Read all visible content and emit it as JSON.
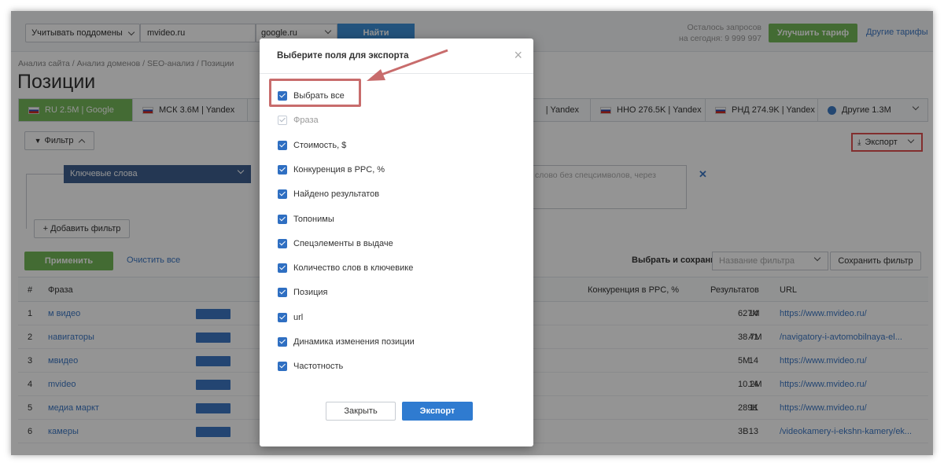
{
  "topbar": {
    "subdomains_label": "Учитывать поддомены",
    "domain_value": "mvideo.ru",
    "search_engine": "google.ru",
    "find_label": "Найти",
    "quota_line1": "Осталось запросов",
    "quota_line2": "на сегодня: 9 999 997",
    "upgrade_label": "Улучшить тариф",
    "other_plans_label": "Другие тарифы"
  },
  "breadcrumb": "Анализ сайта / Анализ доменов / SEO-анализ / Позиции",
  "page_title": "Позиции",
  "region_tabs": [
    {
      "label": "RU 2.5M | Google"
    },
    {
      "label": "МСК 3.6M | Yandex"
    },
    {
      "label": "| Yandex"
    },
    {
      "label": "ННО 276.5K | Yandex"
    },
    {
      "label": "РНД 274.9K | Yandex"
    },
    {
      "label": "Другие 1.3M"
    }
  ],
  "filter": {
    "filter_label": "Фильтр",
    "export_label": "Экспорт",
    "keywords_label": "Ключевые слова",
    "keywords_placeholder": "слово без спецсимволов, через",
    "add_filter_label": "+ Добавить фильтр",
    "apply_label": "Применить",
    "clear_label": "Очистить все",
    "choose_save_label": "Выбрать и сохранить",
    "filter_name_placeholder": "Название фильтра",
    "save_filter_label": "Сохранить фильтр"
  },
  "table": {
    "headers": {
      "num": "#",
      "phrase": "Фраза",
      "ppc": "Конкуренция в PPC, %",
      "results": "Результатов",
      "url": "URL"
    },
    "rows": [
      {
        "num": "1",
        "phrase": "м видео",
        "ppc": "14",
        "results": "627M",
        "url": "https://www.mvideo.ru/"
      },
      {
        "num": "2",
        "phrase": "навигаторы",
        "ppc": "41",
        "results": "38.7M",
        "url": "/navigatory-i-avtomobilnaya-el..."
      },
      {
        "num": "3",
        "phrase": "мвидео",
        "ppc": "14",
        "results": "5M",
        "url": "https://www.mvideo.ru/"
      },
      {
        "num": "4",
        "phrase": "mvideo",
        "ppc": "14",
        "results": "10.2M",
        "url": "https://www.mvideo.ru/"
      },
      {
        "num": "5",
        "phrase": "медиа маркт",
        "ppc": "11",
        "results": "289K",
        "url": "https://www.mvideo.ru/"
      },
      {
        "num": "6",
        "phrase": "камеры",
        "ppc": "13",
        "results": "3B",
        "url": "/videokamery-i-ekshn-kamery/ek..."
      }
    ]
  },
  "modal": {
    "title": "Выберите поля для экспорта",
    "fields": [
      {
        "label": "Выбрать все",
        "checked": true
      },
      {
        "label": "Фраза",
        "checked": true,
        "disabled": true
      },
      {
        "label": "Стоимость, $",
        "checked": true
      },
      {
        "label": "Конкуренция в PPC, %",
        "checked": true
      },
      {
        "label": "Найдено результатов",
        "checked": true
      },
      {
        "label": "Топонимы",
        "checked": true
      },
      {
        "label": "Спецэлементы в выдаче",
        "checked": true
      },
      {
        "label": "Количество слов в ключевике",
        "checked": true
      },
      {
        "label": "Позиция",
        "checked": true
      },
      {
        "label": "url",
        "checked": true
      },
      {
        "label": "Динамика изменения позиции",
        "checked": true
      },
      {
        "label": "Частотность",
        "checked": true
      }
    ],
    "close_label": "Закрыть",
    "export_label": "Экспорт"
  },
  "colors": {
    "accent_green": "#74b958",
    "accent_blue": "#2f7bd0",
    "highlight_red": "#c86c6c"
  }
}
